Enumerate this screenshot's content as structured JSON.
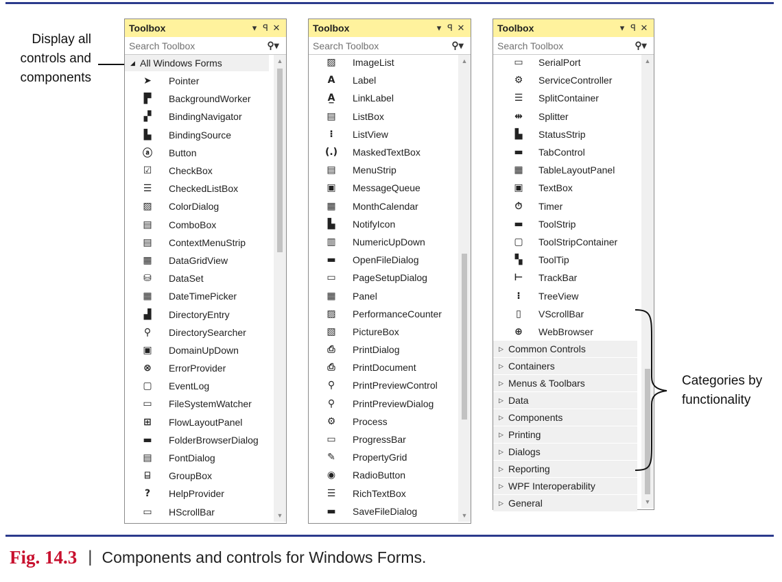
{
  "callouts": {
    "left_lines": [
      "Display all",
      "controls and",
      "components"
    ],
    "right_lines": [
      "Categories by",
      "functionality"
    ]
  },
  "toolboxes": [
    {
      "title": "Toolbox",
      "pin_glyph": "▾",
      "pin2_glyph": "ᵖ",
      "close_glyph": "✕",
      "search_placeholder": "Search Toolbox",
      "group_header": "All Windows Forms",
      "items": [
        {
          "label": "Pointer",
          "icon": "pointer-icon",
          "glyph": "➤"
        },
        {
          "label": "BackgroundWorker",
          "icon": "background-worker-icon",
          "glyph": "▛"
        },
        {
          "label": "BindingNavigator",
          "icon": "binding-navigator-icon",
          "glyph": "▞"
        },
        {
          "label": "BindingSource",
          "icon": "binding-source-icon",
          "glyph": "▙"
        },
        {
          "label": "Button",
          "icon": "button-icon",
          "glyph": "ⓐ"
        },
        {
          "label": "CheckBox",
          "icon": "checkbox-icon",
          "glyph": "☑"
        },
        {
          "label": "CheckedListBox",
          "icon": "checked-listbox-icon",
          "glyph": "☰"
        },
        {
          "label": "ColorDialog",
          "icon": "color-dialog-icon",
          "glyph": "▨"
        },
        {
          "label": "ComboBox",
          "icon": "combobox-icon",
          "glyph": "▤"
        },
        {
          "label": "ContextMenuStrip",
          "icon": "context-menu-strip-icon",
          "glyph": "▤"
        },
        {
          "label": "DataGridView",
          "icon": "datagridview-icon",
          "glyph": "▦"
        },
        {
          "label": "DataSet",
          "icon": "dataset-icon",
          "glyph": "⛁"
        },
        {
          "label": "DateTimePicker",
          "icon": "datetimepicker-icon",
          "glyph": "▦"
        },
        {
          "label": "DirectoryEntry",
          "icon": "directory-entry-icon",
          "glyph": "▟"
        },
        {
          "label": "DirectorySearcher",
          "icon": "directory-searcher-icon",
          "glyph": "⚲"
        },
        {
          "label": "DomainUpDown",
          "icon": "domain-updown-icon",
          "glyph": "▣"
        },
        {
          "label": "ErrorProvider",
          "icon": "error-provider-icon",
          "glyph": "⊗"
        },
        {
          "label": "EventLog",
          "icon": "eventlog-icon",
          "glyph": "▢"
        },
        {
          "label": "FileSystemWatcher",
          "icon": "filesystem-watcher-icon",
          "glyph": "▭"
        },
        {
          "label": "FlowLayoutPanel",
          "icon": "flow-layout-panel-icon",
          "glyph": "⊞"
        },
        {
          "label": "FolderBrowserDialog",
          "icon": "folder-browser-dialog-icon",
          "glyph": "▬"
        },
        {
          "label": "FontDialog",
          "icon": "font-dialog-icon",
          "glyph": "▤"
        },
        {
          "label": "GroupBox",
          "icon": "groupbox-icon",
          "glyph": "⌸"
        },
        {
          "label": "HelpProvider",
          "icon": "help-provider-icon",
          "glyph": "?"
        },
        {
          "label": "HScrollBar",
          "icon": "hscrollbar-icon",
          "glyph": "▭"
        }
      ]
    },
    {
      "title": "Toolbox",
      "pin_glyph": "▾",
      "pin2_glyph": "ᵖ",
      "close_glyph": "✕",
      "search_placeholder": "Search Toolbox",
      "items": [
        {
          "label": "ImageList",
          "icon": "imagelist-icon",
          "glyph": "▨"
        },
        {
          "label": "Label",
          "icon": "label-icon",
          "glyph": "A"
        },
        {
          "label": "LinkLabel",
          "icon": "linklabel-icon",
          "glyph": "A̲"
        },
        {
          "label": "ListBox",
          "icon": "listbox-icon",
          "glyph": "▤"
        },
        {
          "label": "ListView",
          "icon": "listview-icon",
          "glyph": "⁝"
        },
        {
          "label": "MaskedTextBox",
          "icon": "masked-textbox-icon",
          "glyph": "(.)"
        },
        {
          "label": "MenuStrip",
          "icon": "menustrip-icon",
          "glyph": "▤"
        },
        {
          "label": "MessageQueue",
          "icon": "message-queue-icon",
          "glyph": "▣"
        },
        {
          "label": "MonthCalendar",
          "icon": "month-calendar-icon",
          "glyph": "▦"
        },
        {
          "label": "NotifyIcon",
          "icon": "notify-icon-icon",
          "glyph": "▙"
        },
        {
          "label": "NumericUpDown",
          "icon": "numeric-updown-icon",
          "glyph": "▥"
        },
        {
          "label": "OpenFileDialog",
          "icon": "open-file-dialog-icon",
          "glyph": "▬"
        },
        {
          "label": "PageSetupDialog",
          "icon": "page-setup-dialog-icon",
          "glyph": "▭"
        },
        {
          "label": "Panel",
          "icon": "panel-icon",
          "glyph": "▦"
        },
        {
          "label": "PerformanceCounter",
          "icon": "performance-counter-icon",
          "glyph": "▨"
        },
        {
          "label": "PictureBox",
          "icon": "picturebox-icon",
          "glyph": "▧"
        },
        {
          "label": "PrintDialog",
          "icon": "print-dialog-icon",
          "glyph": "⎙"
        },
        {
          "label": "PrintDocument",
          "icon": "print-document-icon",
          "glyph": "⎙"
        },
        {
          "label": "PrintPreviewControl",
          "icon": "print-preview-control-icon",
          "glyph": "⚲"
        },
        {
          "label": "PrintPreviewDialog",
          "icon": "print-preview-dialog-icon",
          "glyph": "⚲"
        },
        {
          "label": "Process",
          "icon": "process-icon",
          "glyph": "⚙"
        },
        {
          "label": "ProgressBar",
          "icon": "progressbar-icon",
          "glyph": "▭"
        },
        {
          "label": "PropertyGrid",
          "icon": "propertygrid-icon",
          "glyph": "✎"
        },
        {
          "label": "RadioButton",
          "icon": "radiobutton-icon",
          "glyph": "◉"
        },
        {
          "label": "RichTextBox",
          "icon": "rich-textbox-icon",
          "glyph": "☰"
        },
        {
          "label": "SaveFileDialog",
          "icon": "save-file-dialog-icon",
          "glyph": "▬"
        }
      ]
    },
    {
      "title": "Toolbox",
      "pin_glyph": "▾",
      "pin2_glyph": "ᵖ",
      "close_glyph": "✕",
      "search_placeholder": "Search Toolbox",
      "items": [
        {
          "label": "SerialPort",
          "icon": "serialport-icon",
          "glyph": "▭"
        },
        {
          "label": "ServiceController",
          "icon": "service-controller-icon",
          "glyph": "⚙"
        },
        {
          "label": "SplitContainer",
          "icon": "split-container-icon",
          "glyph": "☰"
        },
        {
          "label": "Splitter",
          "icon": "splitter-icon",
          "glyph": "⇹"
        },
        {
          "label": "StatusStrip",
          "icon": "statusstrip-icon",
          "glyph": "▙"
        },
        {
          "label": "TabControl",
          "icon": "tabcontrol-icon",
          "glyph": "▬"
        },
        {
          "label": "TableLayoutPanel",
          "icon": "table-layout-panel-icon",
          "glyph": "▦"
        },
        {
          "label": "TextBox",
          "icon": "textbox-icon",
          "glyph": "▣"
        },
        {
          "label": "Timer",
          "icon": "timer-icon",
          "glyph": "⏱"
        },
        {
          "label": "ToolStrip",
          "icon": "toolstrip-icon",
          "glyph": "▬"
        },
        {
          "label": "ToolStripContainer",
          "icon": "toolstrip-container-icon",
          "glyph": "▢"
        },
        {
          "label": "ToolTip",
          "icon": "tooltip-icon",
          "glyph": "▚"
        },
        {
          "label": "TrackBar",
          "icon": "trackbar-icon",
          "glyph": "⊢"
        },
        {
          "label": "TreeView",
          "icon": "treeview-icon",
          "glyph": "⁝"
        },
        {
          "label": "VScrollBar",
          "icon": "vscrollbar-icon",
          "glyph": "▯"
        },
        {
          "label": "WebBrowser",
          "icon": "webbrowser-icon",
          "glyph": "⊕"
        }
      ],
      "categories": [
        "Common Controls",
        "Containers",
        "Menus & Toolbars",
        "Data",
        "Components",
        "Printing",
        "Dialogs",
        "Reporting",
        "WPF Interoperability",
        "General"
      ]
    }
  ],
  "caption": {
    "fig": "Fig. 14.3",
    "separator": "|",
    "text": "Components and controls for Windows Forms."
  },
  "colors": {
    "rule": "#2b3a8c",
    "title_bar": "#fff29d",
    "fig_label": "#c8102e"
  }
}
